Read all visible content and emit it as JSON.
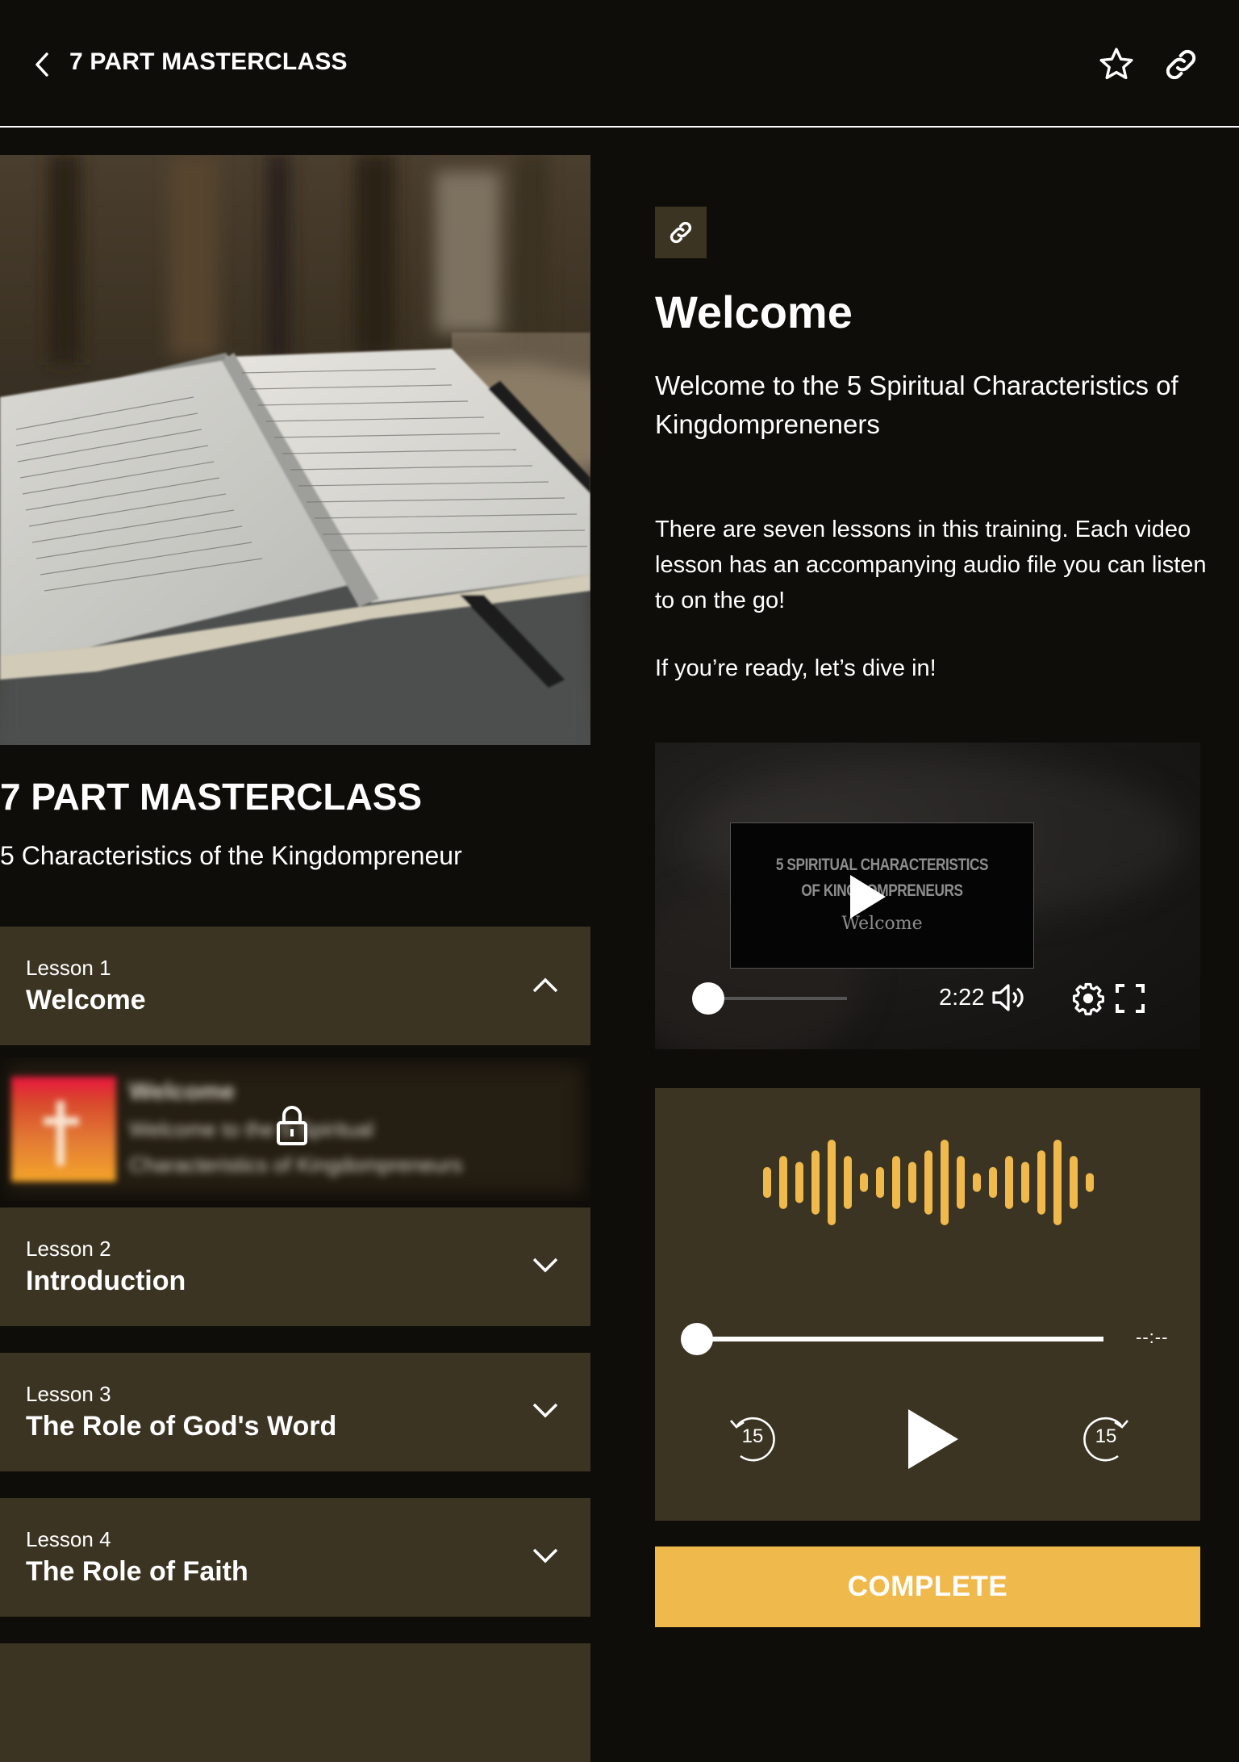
{
  "header": {
    "back_label": "7 PART MASTERCLASS",
    "icons": [
      "chevron-left-icon",
      "star-outline-icon",
      "link-icon"
    ]
  },
  "course": {
    "title": "7 PART MASTERCLASS",
    "subtitle": "5 Characteristics of the Kingdompreneur",
    "hero_image": "open-bible-on-stone"
  },
  "lessons": [
    {
      "number": "Lesson 1",
      "name": "Welcome",
      "expanded": true
    },
    {
      "number": "Lesson 2",
      "name": "Introduction",
      "expanded": false
    },
    {
      "number": "Lesson 3",
      "name": "The Role of God's Word",
      "expanded": false
    },
    {
      "number": "Lesson 4",
      "name": "The Role of Faith",
      "expanded": false
    }
  ],
  "locked_item": {
    "title": "Welcome",
    "line1": "Welcome to the 5 Spiritual",
    "line2": "Characteristics of Kingdompreneurs",
    "icon": "lock-icon"
  },
  "content": {
    "heading": "Welcome",
    "lead": "Welcome to the 5 Spiritual Characteristics of Kingdompreneners",
    "body": [
      "There are seven lessons in this training. Each video lesson has an accompanying audio file you can listen to on the go!",
      "If you’re ready, let’s dive in!"
    ]
  },
  "video": {
    "poster_line1": "5 SPIRITUAL CHARACTERISTICS",
    "poster_line2": "OF KINGDOMPRENEURS",
    "poster_line3": "Welcome",
    "duration": "2:22",
    "progress": 0
  },
  "audio": {
    "time": "--:--",
    "progress": 0,
    "rewind_seconds": "15",
    "forward_seconds": "15",
    "wave_color": "#f0b94b"
  },
  "complete_label": "COMPLETE",
  "colors": {
    "background": "#0f0d09",
    "panel": "#3c3422",
    "accent": "#f0b94b"
  }
}
